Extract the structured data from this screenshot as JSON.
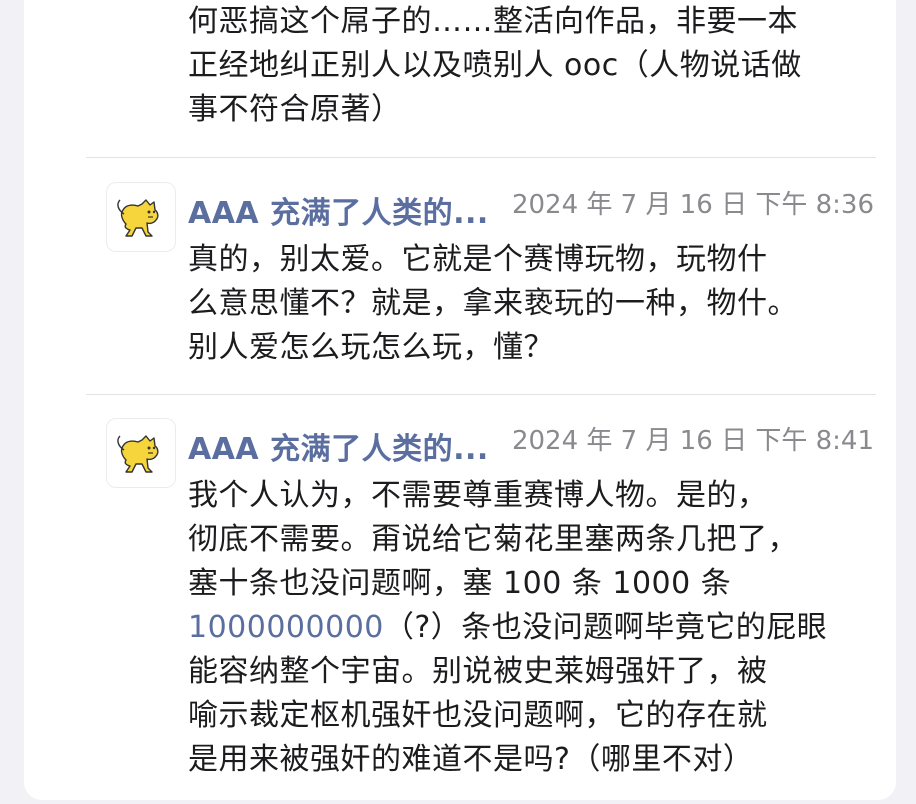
{
  "top_post": {
    "lines": [
      "何恶搞这个屌子的……整活向作品，非要一本",
      "正经地纠正别人以及喷别人 ooc（人物说话做",
      "事不符合原著）"
    ]
  },
  "comments": [
    {
      "author": "AAA 充满了人类的...",
      "timestamp": "2024 年 7 月 16 日 下午 8:36",
      "lines": [
        "真的，别太爱。它就是个赛博玩物，玩物什",
        "么意思懂不？就是，拿来亵玩的一种，物什。",
        "别人爱怎么玩怎么玩，懂？"
      ]
    },
    {
      "author": "AAA 充满了人类的...",
      "timestamp": "2024 年 7 月 16 日 下午 8:41",
      "lines": [
        "我个人认为，不需要尊重赛博人物。是的，",
        "彻底不需要。甭说给它菊花里塞两条几把了，",
        "塞十条也没问题啊，塞 100 条 1000 条",
        "（?）条也没问题啊毕竟它的屁眼",
        "能容纳整个宇宙。别说被史莱姆强奸了，被",
        "喻示裁定枢机强奸也没问题啊，它的存在就",
        "是用来被强奸的难道不是吗?（哪里不对）"
      ],
      "link_number": "1000000000"
    }
  ],
  "colors": {
    "author": "#5b6ea0",
    "timestamp": "#8a8a8e",
    "text": "#1c1c1e",
    "link": "#5b6ea0",
    "background": "#f2f2f6",
    "card": "#ffffff"
  },
  "icons": {
    "avatar": "yellow-cat-icon"
  }
}
